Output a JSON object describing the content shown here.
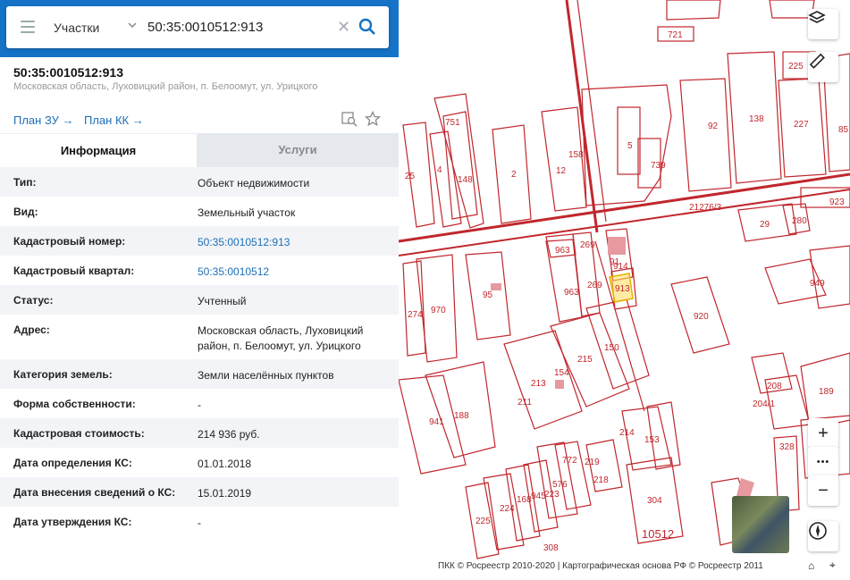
{
  "search": {
    "scope": "Участки",
    "query": "50:35:0010512:913"
  },
  "object": {
    "title": "50:35:0010512:913",
    "address_short": "Московская область, Луховицкий район, п. Белоомут, ул. Урицкого"
  },
  "links": {
    "plan_zu": "План ЗУ →",
    "plan_kk": "План КК →"
  },
  "tabs": {
    "info": "Информация",
    "services": "Услуги"
  },
  "rows": [
    {
      "key": "Тип:",
      "value": "Объект недвижимости",
      "link": false
    },
    {
      "key": "Вид:",
      "value": "Земельный участок",
      "link": false
    },
    {
      "key": "Кадастровый номер:",
      "value": "50:35:0010512:913",
      "link": true
    },
    {
      "key": "Кадастровый квартал:",
      "value": "50:35:0010512",
      "link": true
    },
    {
      "key": "Статус:",
      "value": "Учтенный",
      "link": false
    },
    {
      "key": "Адрес:",
      "value": "Московская область, Луховицкий район, п. Белоомут, ул. Урицкого",
      "link": false
    },
    {
      "key": "Категория земель:",
      "value": "Земли населённых пунктов",
      "link": false
    },
    {
      "key": "Форма собственности:",
      "value": "-",
      "link": false
    },
    {
      "key": "Кадастровая стоимость:",
      "value": "214 936 руб.",
      "link": false
    },
    {
      "key": "Дата определения КС:",
      "value": "01.01.2018",
      "link": false
    },
    {
      "key": "Дата внесения сведений о КС:",
      "value": "15.01.2019",
      "link": false
    },
    {
      "key": "Дата утверждения КС:",
      "value": "-",
      "link": false
    }
  ],
  "map": {
    "labels": [
      "721",
      "225",
      "92",
      "138",
      "227",
      "85",
      "751",
      "158",
      "5",
      "739",
      "4",
      "148",
      "2",
      "12",
      "25",
      "21276/3",
      "923",
      "29",
      "280",
      "963",
      "269",
      "91",
      "914",
      "913",
      "95",
      "970",
      "274",
      "963",
      "269",
      "920",
      "949",
      "215",
      "150",
      "213",
      "154",
      "211",
      "208",
      "204/1",
      "941",
      "188",
      "189",
      "214",
      "153",
      "772",
      "219",
      "576",
      "223",
      "945",
      "168",
      "224",
      "225",
      "218",
      "304",
      "328",
      "308",
      "10512"
    ],
    "parcel_color": "#c0272d",
    "selected_color": "#ffe066"
  },
  "map_controls": {
    "zoom_in": "+",
    "more": "•••",
    "zoom_out": "−"
  },
  "copyright": "ПКК © Росреестр 2010-2020 | Картографическая основа РФ © Росреестр 2011"
}
